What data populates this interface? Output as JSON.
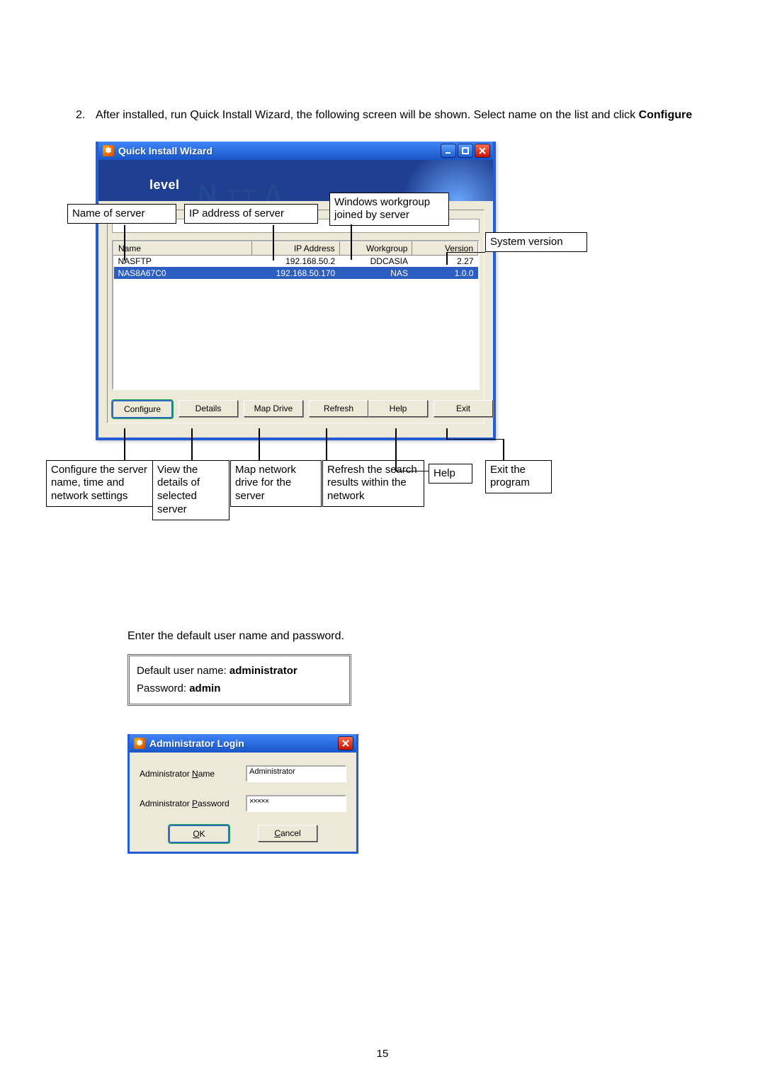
{
  "step": {
    "number": "2.",
    "text_a": "After installed, run Quick Install Wizard, the following screen will be shown. Select name on the list and click ",
    "text_b": "Configure"
  },
  "qiw": {
    "title": "Quick Install Wizard",
    "logo": "level",
    "columns": {
      "name": "Name",
      "ip": "IP Address",
      "wg": "Workgroup",
      "ver": "Version"
    },
    "rows": [
      {
        "name": "NASFTP",
        "ip": "192.168.50.2",
        "wg": "DDCASIA",
        "ver": "2.27",
        "selected": false
      },
      {
        "name": "NAS8A67C0",
        "ip": "192.168.50.170",
        "wg": "NAS",
        "ver": "1.0.0",
        "selected": true
      }
    ],
    "buttons": {
      "configure": "Configure",
      "details": "Details",
      "mapdrive": "Map Drive",
      "refresh": "Refresh",
      "help": "Help",
      "exit": "Exit"
    }
  },
  "ann": {
    "nameofserver": "Name of server",
    "ipofserver": "IP address of server",
    "workgroup": "Windows workgroup joined by server",
    "systemver": "System version",
    "configure": "Configure the server name, time and network settings",
    "details": "View the details of selected server",
    "mapdrive": "Map network drive for the server",
    "refresh": "Refresh the search results within the network",
    "help": "Help",
    "exit": "Exit the program"
  },
  "lower": {
    "intro": "Enter the default user name and password.",
    "line1a": "Default user name: ",
    "line1b": "administrator",
    "line2a": "Password: ",
    "line2b": "admin"
  },
  "login": {
    "title": "Administrator Login",
    "lbl_name_pre": "Administrator ",
    "lbl_name_u": "N",
    "lbl_name_post": "ame",
    "lbl_pass_pre": "Administrator ",
    "lbl_pass_u": "P",
    "lbl_pass_post": "assword",
    "val_name": "Administrator",
    "val_pass": "×××××",
    "ok_u": "O",
    "ok_post": "K",
    "cancel_u": "C",
    "cancel_post": "ancel"
  },
  "pageno": "15"
}
